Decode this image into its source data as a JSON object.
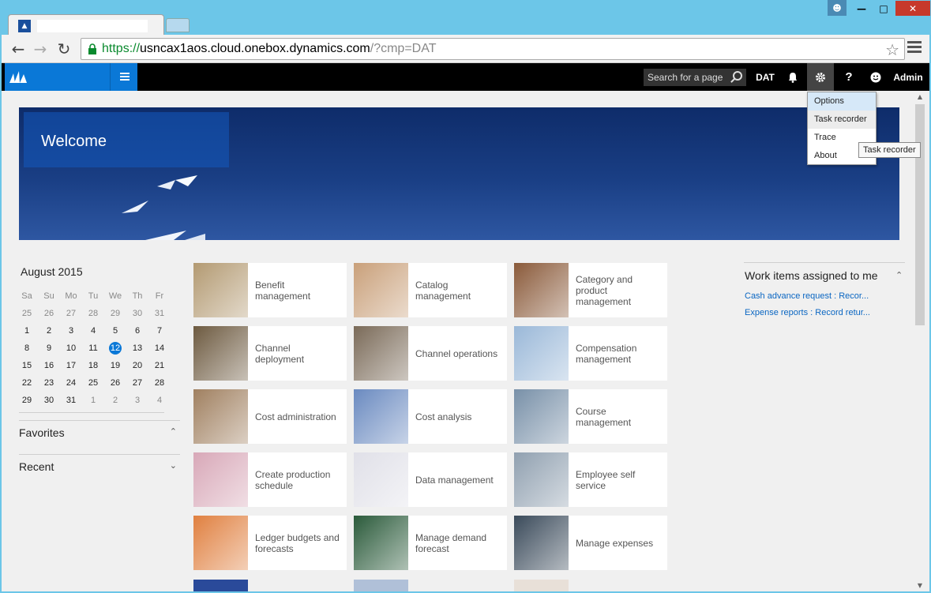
{
  "browser": {
    "url_scheme": "https://",
    "url_host": "usncax1aos.cloud.onebox.dynamics.com",
    "url_rest": "/?cmp=DAT"
  },
  "appbar": {
    "search_placeholder": "Search for a page",
    "company": "DAT",
    "help_label": "?",
    "user": "Admin"
  },
  "banner": {
    "welcome": "Welcome"
  },
  "calendar": {
    "title": "August 2015",
    "weekdays": [
      "Sa",
      "Su",
      "Mo",
      "Tu",
      "We",
      "Th",
      "Fr"
    ],
    "weeks": [
      [
        "25",
        "26",
        "27",
        "28",
        "29",
        "30",
        "31"
      ],
      [
        "1",
        "2",
        "3",
        "4",
        "5",
        "6",
        "7"
      ],
      [
        "8",
        "9",
        "10",
        "11",
        "12",
        "13",
        "14"
      ],
      [
        "15",
        "16",
        "17",
        "18",
        "19",
        "20",
        "21"
      ],
      [
        "22",
        "23",
        "24",
        "25",
        "26",
        "27",
        "28"
      ],
      [
        "29",
        "30",
        "31",
        "1",
        "2",
        "3",
        "4"
      ]
    ],
    "today": "12"
  },
  "sidebar": {
    "favorites": "Favorites",
    "recent": "Recent"
  },
  "tiles": [
    {
      "label": "Benefit management",
      "color": "#b39a72"
    },
    {
      "label": "Catalog management",
      "color": "#c9a07a"
    },
    {
      "label": "Category and product management",
      "color": "#8a5a3a"
    },
    {
      "label": "Channel deployment",
      "color": "#6d5a40"
    },
    {
      "label": "Channel operations",
      "color": "#7a6a58"
    },
    {
      "label": "Compensation management",
      "color": "#9ab8d8"
    },
    {
      "label": "Cost administration",
      "color": "#a08060"
    },
    {
      "label": "Cost analysis",
      "color": "#6a8ac0"
    },
    {
      "label": "Course management",
      "color": "#7890a8"
    },
    {
      "label": "Create production schedule",
      "color": "#d8a8b8"
    },
    {
      "label": "Data management",
      "color": "#e0e0e8"
    },
    {
      "label": "Employee self service",
      "color": "#90a0b0"
    },
    {
      "label": "Ledger budgets and forecasts",
      "color": "#e08040"
    },
    {
      "label": "Manage demand forecast",
      "color": "#2a5a3a"
    },
    {
      "label": "Manage expenses",
      "color": "#3a4a5a"
    }
  ],
  "work_items": {
    "title": "Work items assigned to me",
    "links": [
      "Cash advance request : Recor...",
      "Expense reports : Record retur..."
    ]
  },
  "settings_menu": {
    "items": [
      "Options",
      "Task recorder",
      "Trace",
      "About"
    ]
  },
  "tooltip": "Task recorder"
}
